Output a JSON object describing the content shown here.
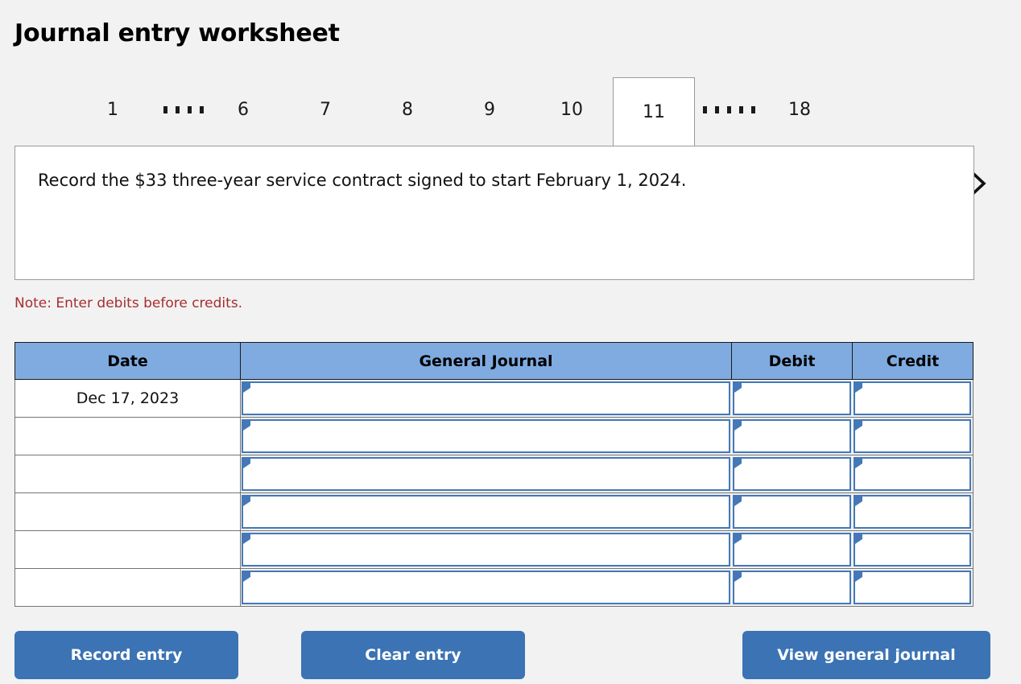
{
  "page_title": "Journal entry worksheet",
  "tabs": {
    "prev_icon": "chevron-left-icon",
    "next_icon": "chevron-right-icon",
    "items": [
      {
        "type": "tab",
        "label": "1",
        "active": false
      },
      {
        "type": "dots",
        "label": "....",
        "count": 4
      },
      {
        "type": "tab",
        "label": "6",
        "active": false
      },
      {
        "type": "tab",
        "label": "7",
        "active": false
      },
      {
        "type": "tab",
        "label": "8",
        "active": false
      },
      {
        "type": "tab",
        "label": "9",
        "active": false
      },
      {
        "type": "tab",
        "label": "10",
        "active": false
      },
      {
        "type": "tab",
        "label": "11",
        "active": true
      },
      {
        "type": "dots",
        "label": ".....",
        "count": 5
      },
      {
        "type": "tab",
        "label": "18",
        "active": false
      }
    ],
    "active_label": "11"
  },
  "scenario": {
    "text": "Record the $33 three-year service contract signed to start February 1, 2024."
  },
  "note": "Note: Enter debits before credits.",
  "table": {
    "headers": [
      "Date",
      "General Journal",
      "Debit",
      "Credit"
    ],
    "rows": [
      {
        "date": "Dec 17, 2023",
        "general_journal": "",
        "debit": "",
        "credit": ""
      },
      {
        "date": "",
        "general_journal": "",
        "debit": "",
        "credit": ""
      },
      {
        "date": "",
        "general_journal": "",
        "debit": "",
        "credit": ""
      },
      {
        "date": "",
        "general_journal": "",
        "debit": "",
        "credit": ""
      },
      {
        "date": "",
        "general_journal": "",
        "debit": "",
        "credit": ""
      },
      {
        "date": "",
        "general_journal": "",
        "debit": "",
        "credit": ""
      }
    ]
  },
  "buttons": {
    "record": "Record entry",
    "clear": "Clear entry",
    "view": "View general journal"
  },
  "colors": {
    "page_background": "#f2f2f2",
    "header_blue": "#7fabe0",
    "field_blue": "#4478b8",
    "button_blue": "#3b73b4",
    "note_red": "#a82d2d",
    "border_gray": "#757575"
  }
}
